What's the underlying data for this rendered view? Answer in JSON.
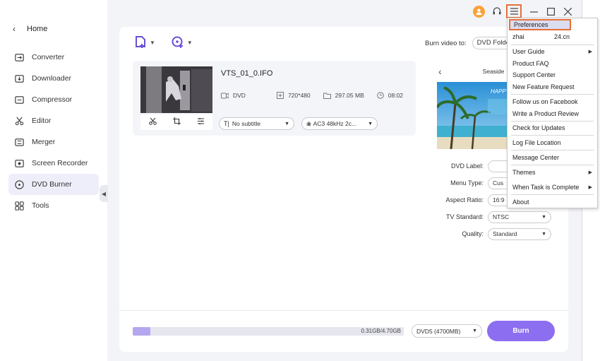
{
  "sidebar": {
    "home_label": "Home",
    "items": [
      {
        "label": "Converter",
        "icon": "converter-icon"
      },
      {
        "label": "Downloader",
        "icon": "downloader-icon"
      },
      {
        "label": "Compressor",
        "icon": "compressor-icon"
      },
      {
        "label": "Editor",
        "icon": "editor-icon"
      },
      {
        "label": "Merger",
        "icon": "merger-icon"
      },
      {
        "label": "Screen Recorder",
        "icon": "screen-recorder-icon"
      },
      {
        "label": "DVD Burner",
        "icon": "dvd-burner-icon",
        "active": true
      },
      {
        "label": "Tools",
        "icon": "tools-icon"
      }
    ]
  },
  "toolbar": {
    "burn_to_label": "Burn video to:",
    "burn_to_value": "DVD Folder"
  },
  "file": {
    "name": "VTS_01_0.IFO",
    "format": "DVD",
    "resolution": "720*480",
    "size": "297.05 MB",
    "duration": "08:02",
    "subtitle": "No subtitle",
    "audio": "AC3 48kHz 2c..."
  },
  "preview": {
    "title": "Seaside",
    "banner_text": "HAPPY"
  },
  "settings": {
    "dvd_label": {
      "label": "DVD Label:",
      "value": ""
    },
    "menu_type": {
      "label": "Menu Type:",
      "value": "Cus"
    },
    "aspect_ratio": {
      "label": "Aspect Ratio:",
      "value": "16:9"
    },
    "tv_standard": {
      "label": "TV Standard:",
      "value": "NTSC"
    },
    "quality": {
      "label": "Quality:",
      "value": "Standard"
    }
  },
  "bottom": {
    "progress_text": "0.31GB/4.70GB",
    "progress_fraction": 0.066,
    "disc_type": "DVD5 (4700MB)",
    "burn_label": "Burn"
  },
  "menu": {
    "preferences": "Preferences",
    "user_left": "zhai",
    "user_right": "24.cn",
    "items": [
      {
        "label": "User Guide",
        "has_submenu": true
      },
      {
        "label": "Product FAQ",
        "has_submenu": false
      },
      {
        "label": "Support Center",
        "has_submenu": false
      },
      {
        "label": "New Feature Request",
        "has_submenu": false
      },
      {
        "label": "Follow us on Facebook",
        "has_submenu": false
      },
      {
        "label": "Write a Product Review",
        "has_submenu": false
      },
      {
        "label": "Check for Updates",
        "has_submenu": false
      },
      {
        "label": "Log File Location",
        "has_submenu": false
      },
      {
        "label": "Message Center",
        "has_submenu": false
      },
      {
        "label": "Themes",
        "has_submenu": true
      },
      {
        "label": "When Task is Complete",
        "has_submenu": true
      },
      {
        "label": "About",
        "has_submenu": false
      }
    ]
  },
  "colors": {
    "accent": "#8c6ef0",
    "highlight": "#e4703a",
    "progress": "#b5a6f0",
    "active_nav": "#eeeefa"
  }
}
